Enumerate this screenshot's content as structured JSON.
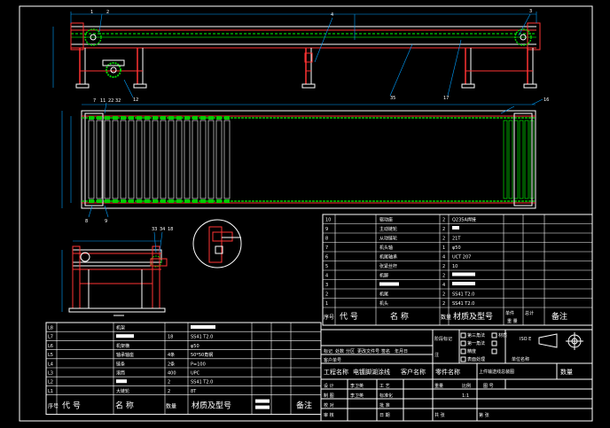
{
  "drawing": {
    "callouts": {
      "c1": "1",
      "c2": "2",
      "c3": "3",
      "c4": "4",
      "c5": "5",
      "c6": "6",
      "c7": "7",
      "c8": "8",
      "c9": "9",
      "c10": "10",
      "c11": "11",
      "c12": "12",
      "c16": "16",
      "c17": "17",
      "c18": "18",
      "c22": "22",
      "c32": "32",
      "c33": "33",
      "c34": "34",
      "c35": "35"
    }
  },
  "bom_upper": {
    "rows": [
      {
        "no": "10",
        "name": "驱动座",
        "qty": "2",
        "spec": "Q235A焊接"
      },
      {
        "no": "9",
        "name": "主动链轮",
        "qty": "2",
        "spec": ""
      },
      {
        "no": "8",
        "name": "从动链轮",
        "qty": "2",
        "spec": "21T"
      },
      {
        "no": "7",
        "name": "机头轴",
        "qty": "1",
        "spec": "φ50"
      },
      {
        "no": "6",
        "name": "机尾轴承",
        "qty": "4",
        "spec": "UCT 207"
      },
      {
        "no": "5",
        "name": "张紧丝杆",
        "qty": "2",
        "spec": "10"
      },
      {
        "no": "4",
        "name": "机脚",
        "qty": "2",
        "spec": ""
      },
      {
        "no": "3",
        "name": "",
        "qty": "4",
        "spec": ""
      },
      {
        "no": "2",
        "name": "机尾",
        "qty": "2",
        "spec": "SS41 T2.0"
      },
      {
        "no": "1",
        "name": "机头",
        "qty": "2",
        "spec": "SS41 T2.0"
      }
    ],
    "header": {
      "no": "序号",
      "code": "代 号",
      "name": "名 称",
      "qty": "数量",
      "spec": "材质及型号",
      "single": "单件",
      "total": "总计",
      "weight": "重 量",
      "remark": "备注"
    }
  },
  "bom_lower": {
    "rows": [
      {
        "no": "L8",
        "name": "机架",
        "qty": "",
        "spec": ""
      },
      {
        "no": "L7",
        "name": "",
        "qty": "18",
        "spec": "SS41 T2.0"
      },
      {
        "no": "L6",
        "name": "机架横",
        "qty": "",
        "spec": "φ50"
      },
      {
        "no": "L5",
        "name": "轴承轴座",
        "qty": "4条",
        "spec": "50*50角钢"
      },
      {
        "no": "L4",
        "name": "链条",
        "qty": "2条",
        "spec": "P=100"
      },
      {
        "no": "L3",
        "name": "滚筒",
        "qty": "400",
        "spec": "UPC"
      },
      {
        "no": "L2",
        "name": "",
        "qty": "2",
        "spec": "SS41 T2.0"
      },
      {
        "no": "L1",
        "name": "大链轮",
        "qty": "2",
        "spec": "8T"
      }
    ],
    "header": {
      "no": "序号",
      "code": "代 号",
      "name": "名 称",
      "qty": "数量",
      "spec": "材质及型号",
      "remark": "备注"
    }
  },
  "title_block": {
    "row_labels": [
      "标记",
      "处数",
      "分区",
      "更改文件号",
      "签名",
      "年月日"
    ],
    "client_no_label": "客户单号",
    "project_label": "工程名称",
    "project_value": "电镀脚湖涂线",
    "client_label": "客户名称",
    "part_label": "零件名称",
    "part_value": "上件输送线总装图",
    "qty_label": "数量",
    "stage_label": "阶段标记",
    "weight_label": "重量",
    "scale_label": "比例",
    "drawing_no_label": "图 号",
    "scale_value": "1:1",
    "sheet_value": "共 张",
    "sheet_of": "第 张",
    "material_label": "材质",
    "precision_label": "精度",
    "surface_label": "表面处理",
    "third_angle": "第三角法",
    "first_angle": "第一角法",
    "roles": [
      {
        "role": "设 计",
        "name": "李卫英",
        "r2": "工 艺"
      },
      {
        "role": "制 图",
        "name": "李卫英",
        "r2": "标准化"
      },
      {
        "role": "校 对",
        "name": "",
        "r2": "批 准"
      },
      {
        "role": "审 核",
        "name": "",
        "r2": "日 期"
      }
    ],
    "unit_label": "单位名称",
    "proj_code": "ISO E",
    "note_label": "注"
  }
}
